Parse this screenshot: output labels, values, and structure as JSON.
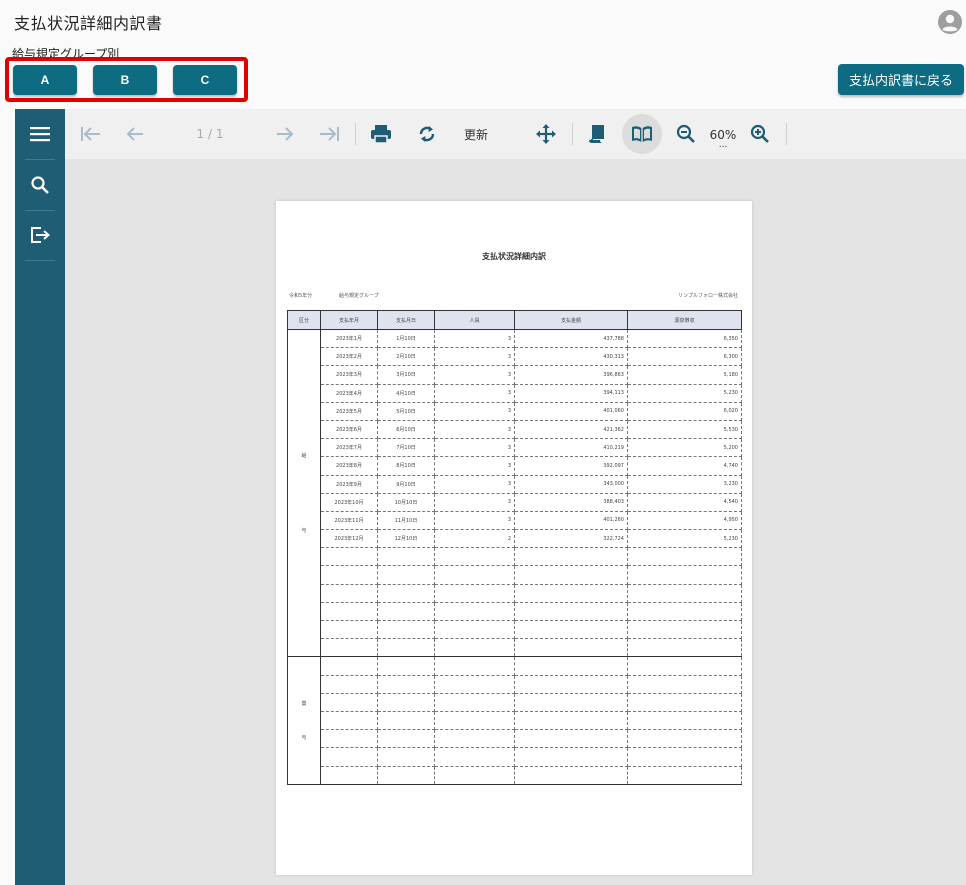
{
  "app": {
    "title": "支払状況詳細内訳書"
  },
  "header": {
    "group_label": "給与規定グループ別",
    "groups": [
      "A",
      "B",
      "C"
    ],
    "back_label": "支払内訳書に戻る"
  },
  "viewer": {
    "page_indicator": "1 / 1",
    "refresh_label": "更新",
    "zoom": "60%",
    "zoom_more": "..."
  },
  "icons": {
    "sidebar": [
      "menu-icon",
      "search-icon",
      "export-icon"
    ],
    "toolbar": [
      "first-page-icon",
      "prev-page-icon",
      "next-page-icon",
      "last-page-icon",
      "print-icon",
      "refresh-icon",
      "move-icon",
      "continuous-page-icon",
      "book-view-icon",
      "zoom-out-icon",
      "zoom-in-icon"
    ]
  },
  "colors": {
    "accent": "#0e6c82",
    "sidebar": "#1e5d73",
    "highlight": "#e00000"
  },
  "report": {
    "title": "支払状況詳細内訳",
    "era": "令和5年分",
    "group": "給与規定グループ",
    "company": "リンプルフォロー株式会社",
    "columns": [
      "区分",
      "支払年月",
      "支払月日",
      "人員",
      "支払金額",
      "源泉徴収"
    ],
    "salary_label": [
      "給",
      "与"
    ],
    "bonus_label": [
      "賞",
      "与"
    ],
    "salary_rows": [
      [
        "2023年1月",
        "1月10日",
        "3",
        "437,788",
        "6,350"
      ],
      [
        "2023年2月",
        "2月10日",
        "3",
        "430,313",
        "6,300"
      ],
      [
        "2023年3月",
        "3月10日",
        "3",
        "396,863",
        "5,180"
      ],
      [
        "2023年4月",
        "4月10日",
        "3",
        "394,113",
        "5,230"
      ],
      [
        "2023年5月",
        "5月10日",
        "3",
        "401,060",
        "6,020"
      ],
      [
        "2023年6月",
        "6月10日",
        "3",
        "421,362",
        "5,530"
      ],
      [
        "2023年7月",
        "7月10日",
        "3",
        "410,219",
        "5,200"
      ],
      [
        "2023年8月",
        "8月10日",
        "3",
        "392,097",
        "4,740"
      ],
      [
        "2023年9月",
        "9月10日",
        "3",
        "343,000",
        "3,230"
      ],
      [
        "2023年10月",
        "10月10日",
        "3",
        "388,403",
        "4,540"
      ],
      [
        "2023年11月",
        "11月10日",
        "3",
        "401,260",
        "4,950"
      ],
      [
        "2023年12月",
        "12月10日",
        "2",
        "322,724",
        "5,230"
      ]
    ],
    "salary_blank_rows": 6,
    "bonus_blank_rows": 7
  }
}
